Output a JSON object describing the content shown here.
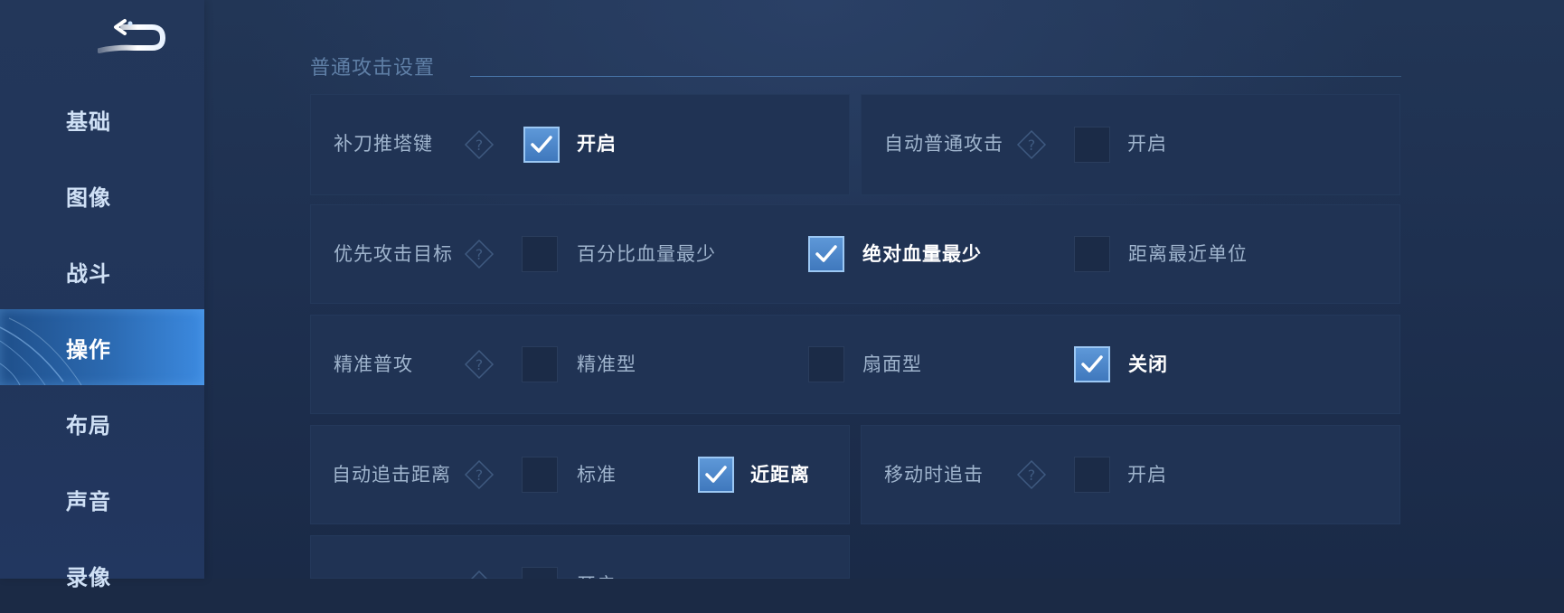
{
  "sidebar": {
    "items": [
      {
        "label": "基础"
      },
      {
        "label": "图像"
      },
      {
        "label": "战斗"
      },
      {
        "label": "操作",
        "active": true
      },
      {
        "label": "布局"
      },
      {
        "label": "声音"
      },
      {
        "label": "录像"
      }
    ]
  },
  "section": {
    "title": "普通攻击设置"
  },
  "settings": {
    "last_hit": {
      "label": "补刀推塔键",
      "option": "开启",
      "checked": true
    },
    "auto_attack": {
      "label": "自动普通攻击",
      "option": "开启",
      "checked": false
    },
    "target_priority": {
      "label": "优先攻击目标",
      "options": [
        {
          "label": "百分比血量最少",
          "checked": false
        },
        {
          "label": "绝对血量最少",
          "checked": true
        },
        {
          "label": "距离最近单位",
          "checked": false
        }
      ]
    },
    "precise_attack": {
      "label": "精准普攻",
      "options": [
        {
          "label": "精准型",
          "checked": false
        },
        {
          "label": "扇面型",
          "checked": false
        },
        {
          "label": "关闭",
          "checked": true
        }
      ]
    },
    "chase_distance": {
      "label": "自动追击距离",
      "options": [
        {
          "label": "标准",
          "checked": false
        },
        {
          "label": "近距离",
          "checked": true
        }
      ]
    },
    "chase_on_move": {
      "label": "移动时追击",
      "option": "开启",
      "checked": false
    },
    "partial_row": {
      "option": "开启",
      "checked": false
    }
  },
  "colors": {
    "accent": "#3c8ae0",
    "check": "#4f8acb",
    "panel": "#203354"
  },
  "icons": {
    "back": "back-arrow-icon",
    "help": "help-diamond-icon",
    "check": "checkmark-icon"
  }
}
